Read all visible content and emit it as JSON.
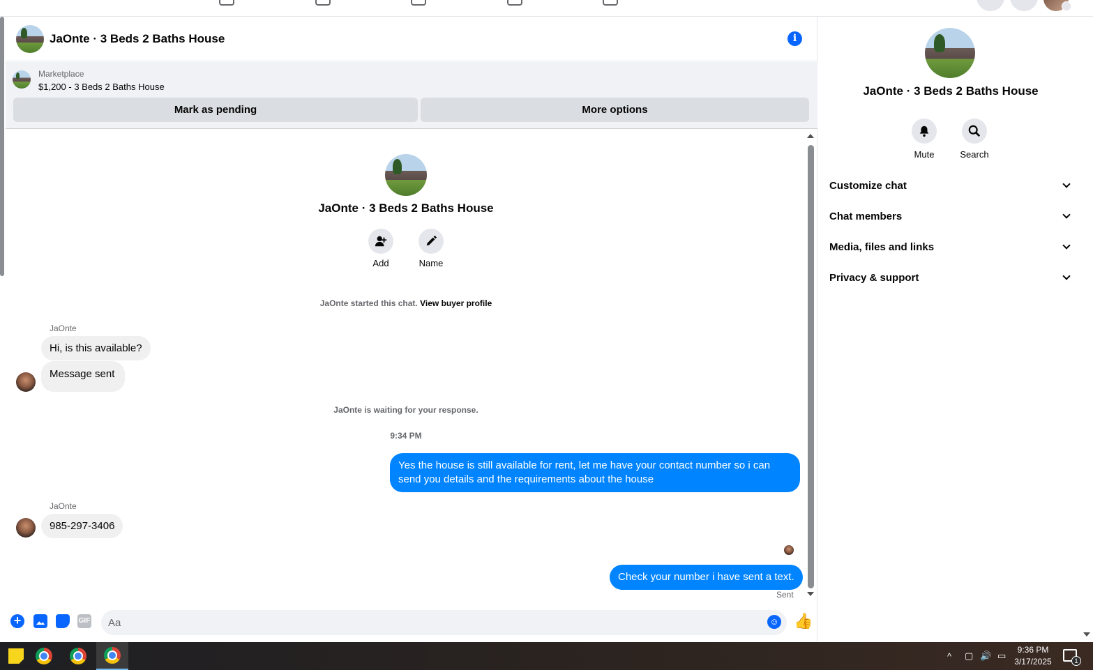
{
  "chat": {
    "title": "JaOnte · 3 Beds 2 Baths House",
    "info_icon": "info-icon"
  },
  "marketplace": {
    "label": "Marketplace",
    "listing": "$1,200 - 3 Beds 2 Baths House",
    "mark_pending_label": "Mark as pending",
    "more_options_label": "More options"
  },
  "intro": {
    "name": "JaOnte · 3 Beds 2 Baths House",
    "add_label": "Add",
    "name_label": "Name",
    "started_text": "JaOnte started this chat.",
    "buyer_profile_link": "View buyer profile"
  },
  "messages": [
    {
      "sender": "JaOnte",
      "text": "Hi, is this available?",
      "direction": "in"
    },
    {
      "sender": "",
      "text": "Message sent",
      "direction": "in"
    },
    {
      "sender": "",
      "text": "Yes the house is still available for rent, let me have your contact number so i can send you details and the requirements about the house",
      "direction": "out"
    },
    {
      "sender": "JaOnte",
      "text": "985-297-3406",
      "direction": "in"
    },
    {
      "sender": "",
      "text": "Check your number i have sent a text.",
      "direction": "out"
    }
  ],
  "system": {
    "waiting_text": "JaOnte is waiting for your response.",
    "time": "9:34 PM",
    "sent_status": "Sent"
  },
  "composer": {
    "placeholder": "Aa",
    "gif_label": "GIF"
  },
  "right_panel": {
    "title": "JaOnte · 3 Beds 2 Baths House",
    "mute_label": "Mute",
    "search_label": "Search",
    "sections": [
      "Customize chat",
      "Chat members",
      "Media, files and links",
      "Privacy & support"
    ]
  },
  "taskbar": {
    "time": "9:36 PM",
    "date": "3/17/2025",
    "notification_count": "1"
  },
  "colors": {
    "accent": "#0866ff",
    "outgoing_bubble": "#0084ff",
    "incoming_bubble": "#f0f0f0"
  }
}
